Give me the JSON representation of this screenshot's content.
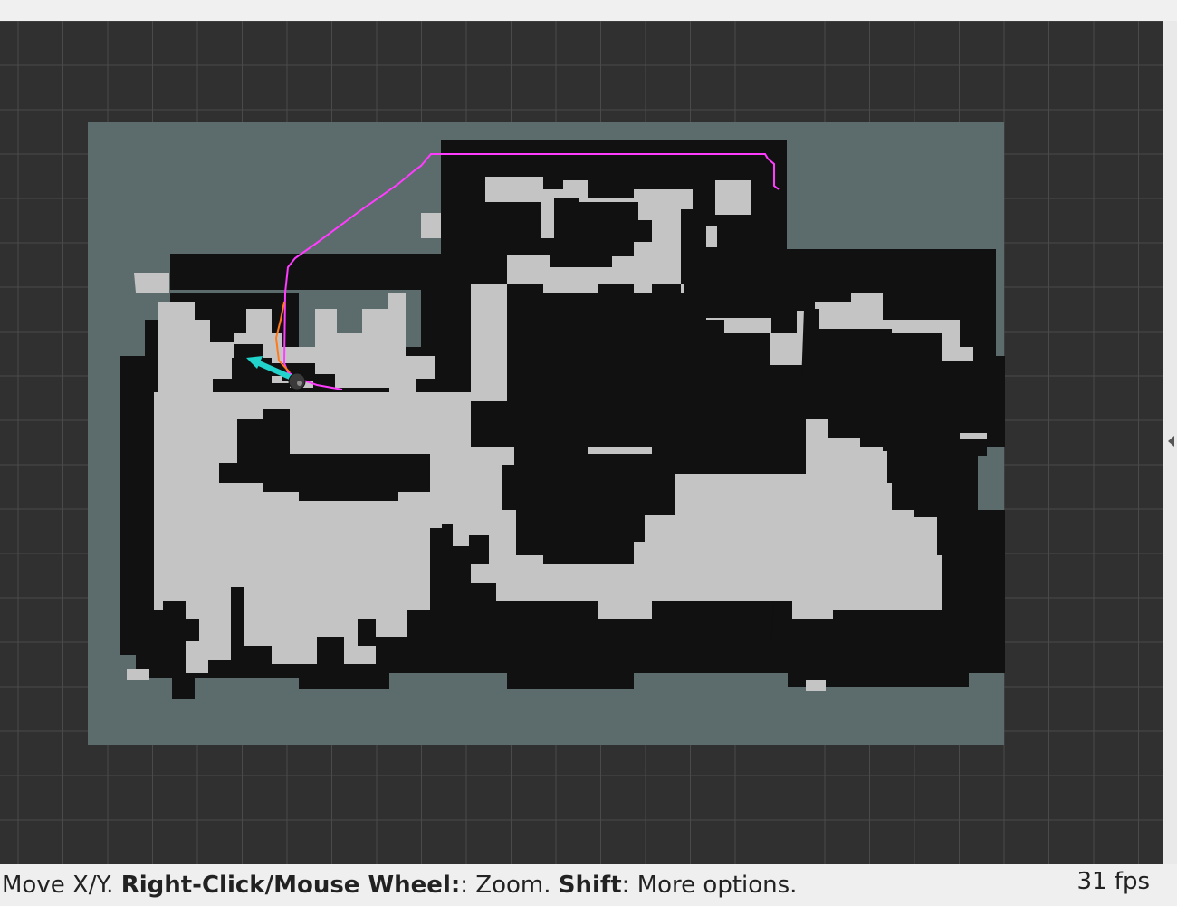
{
  "status": {
    "move_label": "Move X/Y.",
    "zoom_key": "Right-Click/Mouse Wheel:",
    "zoom_label": ": Zoom.",
    "shift_key": "Shift",
    "shift_label": ": More options.",
    "fps": "31 fps"
  },
  "colors": {
    "background": "#303030",
    "grid_line": "#4a4a4a",
    "map_unknown": "#5c6b6b",
    "map_free": "#c4c4c4",
    "map_occupied": "#111111",
    "global_path": "#ff3cff",
    "local_path": "#ff7a1a",
    "goal_arrow": "#22d3cc",
    "robot": "#3a3a3a"
  },
  "icons": {
    "panel_toggle": "triangle-left-icon",
    "robot": "robot-base-icon",
    "pose_arrow": "pose-arrow-icon"
  }
}
